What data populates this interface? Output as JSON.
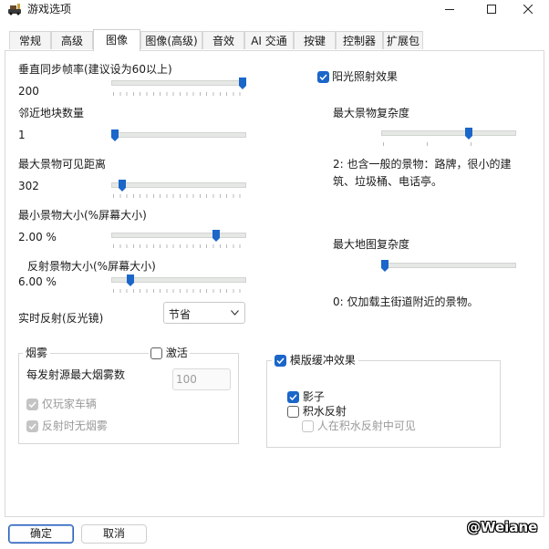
{
  "window": {
    "title": "游戏选项",
    "icon": "game-options-icon"
  },
  "tabs": [
    {
      "label": "常规",
      "active": false
    },
    {
      "label": "高级",
      "active": false
    },
    {
      "label": "图像",
      "active": true
    },
    {
      "label": "图像(高级)",
      "active": false
    },
    {
      "label": "音效",
      "active": false
    },
    {
      "label": "AI 交通",
      "active": false
    },
    {
      "label": "按键",
      "active": false
    },
    {
      "label": "控制器",
      "active": false
    },
    {
      "label": "扩展包",
      "active": false
    }
  ],
  "left": {
    "vsync": {
      "label": "垂直同步帧率(建议设为60以上)",
      "value": "200",
      "level": 1.0
    },
    "nearby_tiles": {
      "label": "邻近地块数量",
      "value": "1",
      "level": 0.0
    },
    "max_scenery_distance": {
      "label": "最大景物可见距离",
      "value": "302",
      "level": 0.06
    },
    "min_scenery_size": {
      "label": "最小景物大小(%屏幕大小)",
      "value": "2.00 %",
      "level": 0.79
    },
    "reflection_size": {
      "label": "反射景物大小(%屏幕大小)",
      "value": "6.00 %",
      "level": 0.12
    },
    "realtime_reflection": {
      "label": "实时反射(反光镜)",
      "selected": "节省"
    }
  },
  "right": {
    "sunlight": {
      "label": "阳光照射效果",
      "checked": true
    },
    "max_scenery_complexity": {
      "label": "最大景物复杂度",
      "level": 0.66,
      "description": "2: 也含一般的景物：路牌，很小的建筑、垃圾桶、电话亭。"
    },
    "max_map_complexity": {
      "label": "最大地图复杂度",
      "level": 0.0,
      "description": "0: 仅加载主街道附近的景物。"
    }
  },
  "fog": {
    "title": "烟雾",
    "activate_label": "激活",
    "activate_checked": false,
    "max_fog_label": "每发射源最大烟雾数",
    "max_fog_value": "100",
    "player_only_label": "仅玩家车辆",
    "no_fog_reflection_label": "反射时无烟雾"
  },
  "stencil": {
    "title": "模版缓冲效果",
    "checked": true,
    "shadow_label": "影子",
    "shadow_checked": true,
    "puddle_label": "积水反射",
    "puddle_checked": false,
    "people_in_puddle_label": "人在积水反射中可见"
  },
  "buttons": {
    "ok": "确定",
    "cancel": "取消"
  },
  "watermark": "@Weiane",
  "colors": {
    "accent": "#1b66c9",
    "disabled": "#9a9a9a"
  }
}
